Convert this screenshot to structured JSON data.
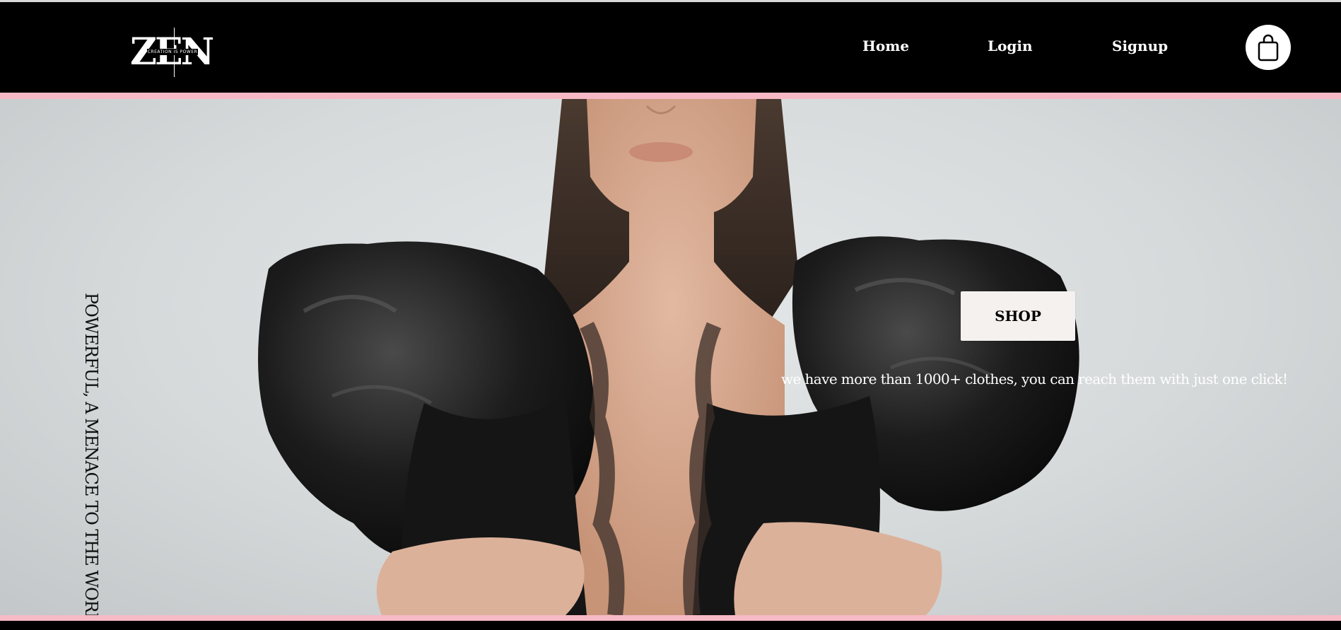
{
  "brand": {
    "logo_text": "ZEN",
    "logo_tagline": "CREATION IS POWER"
  },
  "nav": {
    "items": [
      {
        "label": "Home"
      },
      {
        "label": "Login"
      },
      {
        "label": "Signup"
      }
    ],
    "cart_icon": "shopping-bag-icon"
  },
  "hero": {
    "vertical_text": "POWERFUL, A MENACE TO THE WORLD",
    "shop_label": "SHOP",
    "tagline": "we have more than 1000+ clothes, you can reach them with just one click!",
    "image": "model-in-black-puff-sleeve-jacket"
  },
  "colors": {
    "nav_bg": "#000000",
    "accent_pink": "#f7b9c5",
    "button_bg": "#f4f1ee"
  }
}
